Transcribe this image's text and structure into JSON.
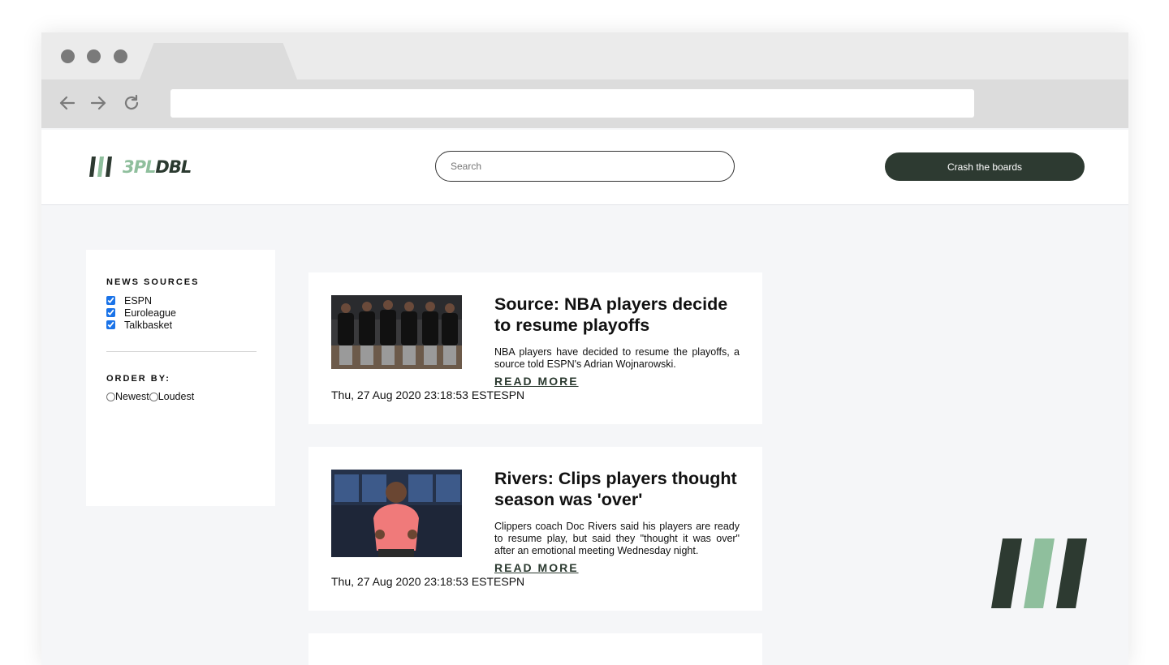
{
  "browser": {
    "address_value": ""
  },
  "header": {
    "logo": {
      "part1": "3PL",
      "part2": "DBL"
    },
    "search_placeholder": "Search",
    "cta_label": "Crash the boards"
  },
  "sidebar": {
    "sources_heading": "NEWS SOURCES",
    "sources": [
      {
        "label": "ESPN",
        "checked": true
      },
      {
        "label": "Euroleague",
        "checked": true
      },
      {
        "label": "Talkbasket",
        "checked": true
      }
    ],
    "order_heading": "ORDER BY:",
    "order_options": [
      {
        "label": "Newest",
        "checked": false
      },
      {
        "label": "Loudest",
        "checked": false
      }
    ]
  },
  "articles": [
    {
      "title": "Source: NBA players decide to resume playoffs",
      "description": "NBA players have decided to resume the playoffs, a source told ESPN's Adrian Wojnarowski.",
      "read_more": "READ MORE",
      "date": "Thu, 27 Aug 2020 23:18:53 EST",
      "source": "ESPN"
    },
    {
      "title": "Rivers: Clips players thought season was 'over'",
      "description": "Clippers coach Doc Rivers said his players are ready to resume play, but said they \"thought it was over\" after an emotional meeting Wednesday night.",
      "read_more": "READ MORE",
      "date": "Thu, 27 Aug 2020 23:18:53 EST",
      "source": "ESPN"
    }
  ],
  "colors": {
    "brand_dark": "#2d3a31",
    "brand_light": "#8fbf9d",
    "page_bg": "#f5f6f8"
  }
}
